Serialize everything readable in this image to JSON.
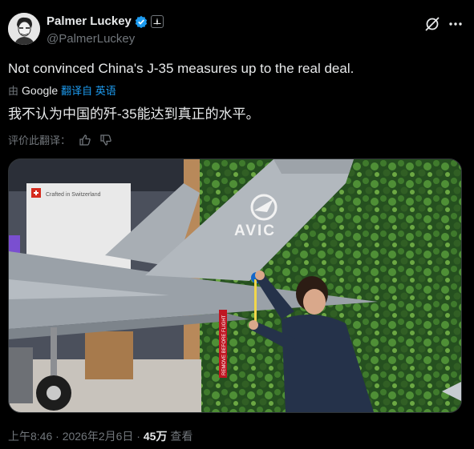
{
  "author": {
    "display_name": "Palmer Luckey",
    "handle": "@PalmerLuckey"
  },
  "icons": {
    "verified": "verified-badge-icon",
    "affiliation": "affiliate-badge-icon",
    "grok": "grok-icon",
    "more": "more-dots-icon",
    "thumb_up": "thumbs-up-icon",
    "thumb_down": "thumbs-down-icon"
  },
  "tweet": {
    "text": "Not convinced China's J-35 measures up to the real deal.",
    "translated_by_prefix": "由",
    "translated_by_brand": "Google",
    "translated_from": "翻译自 英语",
    "translated_text": "我不认为中国的歼-35能达到真正的水平。",
    "rate_translation": "评价此翻译："
  },
  "media": {
    "booth_sign": "Crafted in Switzerland",
    "tail_logo": "AVIC",
    "tag_text": "REMOVE BEFORE FLIGHT"
  },
  "meta": {
    "time": "上午8:46",
    "sep1": " · ",
    "date": "2026年2月6日",
    "sep2": " · ",
    "views": "45万",
    "views_label": " 查看"
  },
  "colors": {
    "background": "#000000",
    "accent": "#1d9bf0",
    "text": "#e7e9ea",
    "muted": "#71767b"
  }
}
